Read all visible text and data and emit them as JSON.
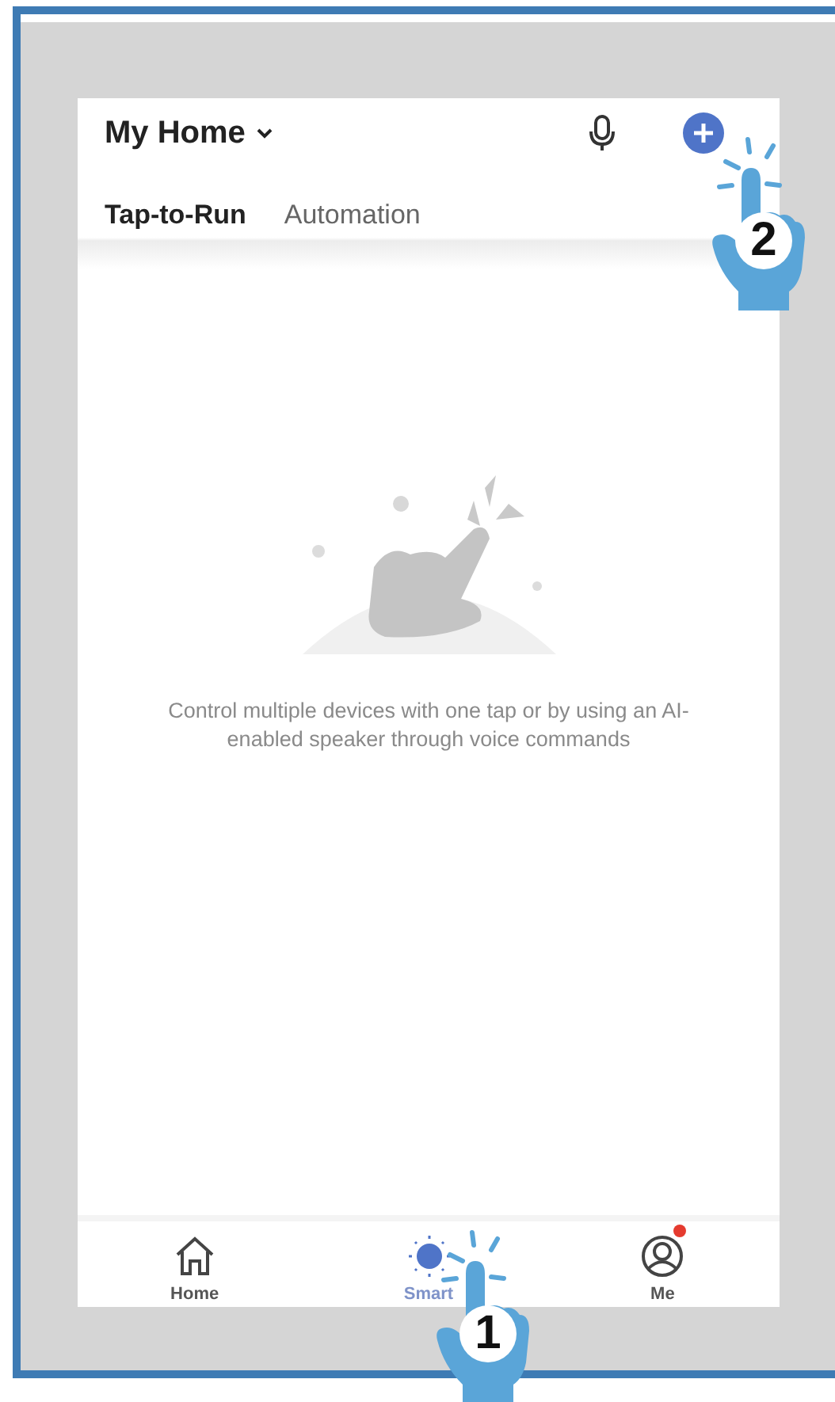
{
  "header": {
    "title": "My Home"
  },
  "tabs": [
    {
      "label": "Tap-to-Run",
      "selected": true
    },
    {
      "label": "Automation",
      "selected": false
    }
  ],
  "empty_state": {
    "message": "Control multiple devices with one tap or by using an AI-enabled speaker through voice commands"
  },
  "bottom_nav": [
    {
      "label": "Home",
      "kind": "home",
      "selected": false,
      "notification": false
    },
    {
      "label": "Smart",
      "kind": "smart",
      "selected": true,
      "notification": false
    },
    {
      "label": "Me",
      "kind": "me",
      "selected": false,
      "notification": true
    }
  ],
  "callouts": [
    {
      "number": "2"
    },
    {
      "number": "1"
    }
  ]
}
